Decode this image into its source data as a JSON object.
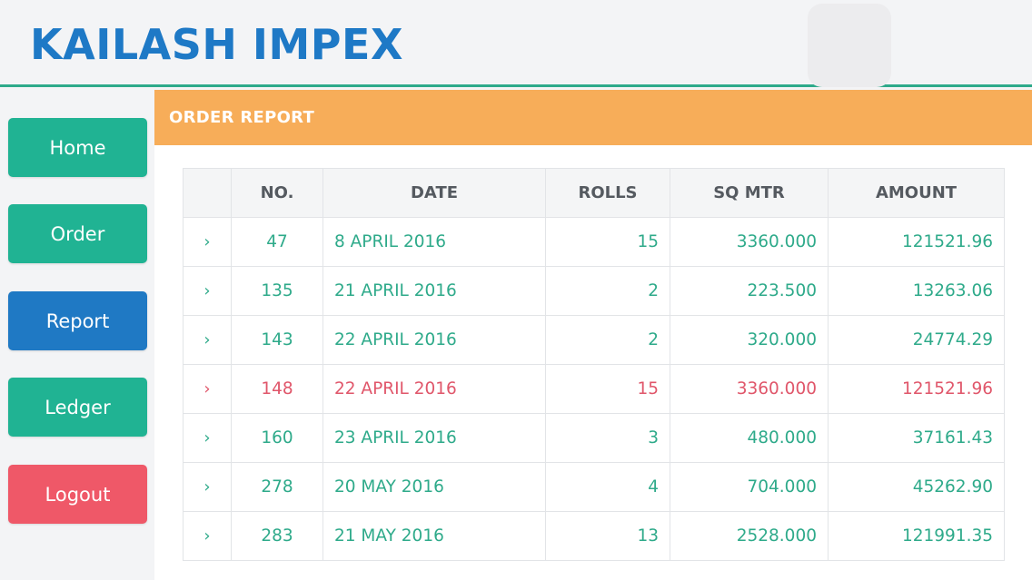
{
  "app": {
    "title": "KAILASH IMPEX"
  },
  "colors": {
    "brand": "#1e79c6",
    "teal": "#2eaa8a",
    "blue": "#1e79c6",
    "red": "#e0566a",
    "orange": "#f7ad59"
  },
  "sidebar": {
    "items": [
      {
        "label": "Home",
        "color": "#20b393"
      },
      {
        "label": "Order",
        "color": "#20b393"
      },
      {
        "label": "Report",
        "color": "#1f79c4"
      },
      {
        "label": "Ledger",
        "color": "#20b393"
      },
      {
        "label": "Logout",
        "color": "#ef5868"
      }
    ]
  },
  "report": {
    "title": "ORDER REPORT",
    "columns": [
      "",
      "NO.",
      "DATE",
      "ROLLS",
      "SQ MTR",
      "AMOUNT"
    ],
    "rows": [
      {
        "arrow": "›",
        "no": "47",
        "date": "8 APRIL 2016",
        "rolls": "15",
        "sqmtr": "3360.000",
        "amount": "121521.96",
        "status": "ok"
      },
      {
        "arrow": "›",
        "no": "135",
        "date": "21 APRIL 2016",
        "rolls": "2",
        "sqmtr": "223.500",
        "amount": "13263.06",
        "status": "ok"
      },
      {
        "arrow": "›",
        "no": "143",
        "date": "22 APRIL 2016",
        "rolls": "2",
        "sqmtr": "320.000",
        "amount": "24774.29",
        "status": "ok"
      },
      {
        "arrow": "›",
        "no": "148",
        "date": "22 APRIL 2016",
        "rolls": "15",
        "sqmtr": "3360.000",
        "amount": "121521.96",
        "status": "bad"
      },
      {
        "arrow": "›",
        "no": "160",
        "date": "23 APRIL 2016",
        "rolls": "3",
        "sqmtr": "480.000",
        "amount": "37161.43",
        "status": "ok"
      },
      {
        "arrow": "›",
        "no": "278",
        "date": "20 MAY 2016",
        "rolls": "4",
        "sqmtr": "704.000",
        "amount": "45262.90",
        "status": "ok"
      },
      {
        "arrow": "›",
        "no": "283",
        "date": "21 MAY 2016",
        "rolls": "13",
        "sqmtr": "2528.000",
        "amount": "121991.35",
        "status": "ok"
      }
    ]
  }
}
